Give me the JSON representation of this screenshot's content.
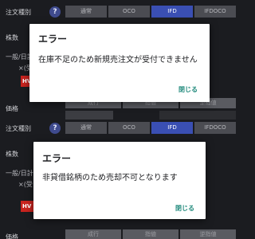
{
  "screens": [
    {
      "order_type_label": "注文種別",
      "help_icon": "?",
      "order_types": [
        "通常",
        "OCO",
        "IFD",
        "IFDOCO"
      ],
      "selected_index": 2,
      "quantity_label": "株数",
      "sub_label_1": "一般/日計",
      "sub_label_2": "×(受",
      "badge": "HV",
      "bottom_label": "価格",
      "bottom_options": [
        "成行",
        "指値",
        "逆指値"
      ],
      "dialog": {
        "title": "エラー",
        "message": "在庫不足のため新規売注文が受付できません",
        "close": "閉じる"
      }
    },
    {
      "order_type_label": "注文種別",
      "help_icon": "?",
      "order_types": [
        "通常",
        "OCO",
        "IFD",
        "IFDOCO"
      ],
      "selected_index": 2,
      "quantity_label": "株数",
      "sub_label_1": "一般/日計",
      "sub_label_2": "×(受",
      "badge": "HV",
      "bottom_label": "価格",
      "bottom_options": [
        "成行",
        "指値",
        "逆指値"
      ],
      "dialog": {
        "title": "エラー",
        "message": "非貸借銘柄のため売却不可となります",
        "close": "閉じる"
      }
    }
  ]
}
